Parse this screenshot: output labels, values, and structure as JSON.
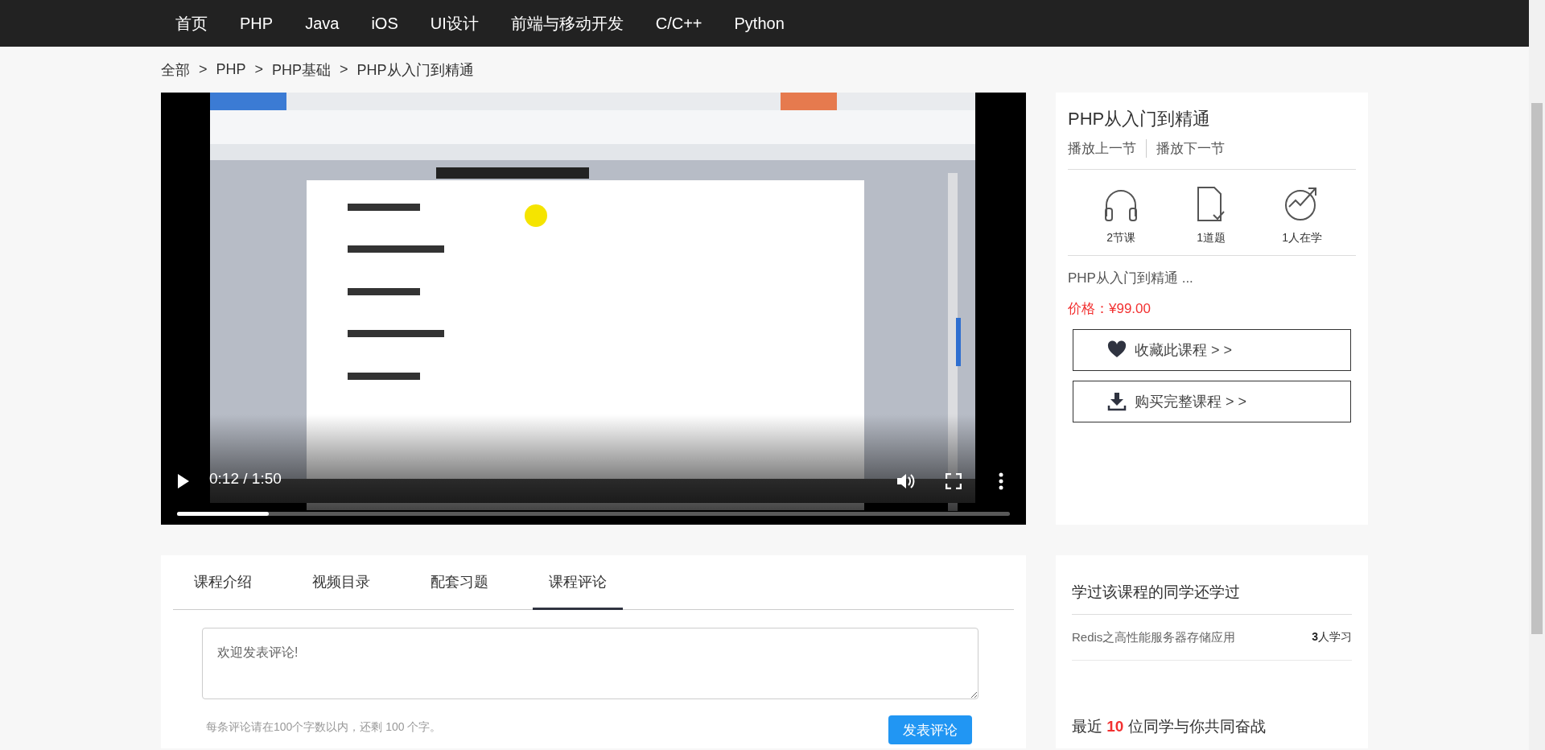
{
  "nav": {
    "items": [
      "首页",
      "PHP",
      "Java",
      "iOS",
      "UI设计",
      "前端与移动开发",
      "C/C++",
      "Python"
    ]
  },
  "breadcrumb": {
    "items": [
      "全部",
      "PHP",
      "PHP基础",
      "PHP从入门到精通"
    ],
    "separators": [
      ">",
      ">",
      ">"
    ]
  },
  "video": {
    "kind": "picture",
    "playing": false,
    "time": "0:12 / 1:50",
    "level": 0.11
  },
  "course": {
    "title": "PHP从入门到精通",
    "prev": "播放上一节",
    "next": "播放下一节",
    "stats": [
      {
        "kind": "headphones",
        "label": "2节课"
      },
      {
        "kind": "document",
        "label": "1道题"
      },
      {
        "kind": "growth",
        "label": "1人在学"
      }
    ],
    "summary": "PHP从入门到精通 ...",
    "price": "价格：¥99.00",
    "actions": [
      {
        "kind": "favorite",
        "label": "收藏此课程 > >"
      },
      {
        "kind": "download",
        "label": "购买完整课程 > >"
      }
    ]
  },
  "tabs": [
    {
      "label": "课程介绍",
      "selected": false
    },
    {
      "label": "视频目录",
      "selected": false
    },
    {
      "label": "配套习题",
      "selected": false
    },
    {
      "label": "课程评论",
      "selected": true
    }
  ],
  "comment": {
    "placeholder": "欢迎发表评论!",
    "hint": "每条评论请在100个字数以内，还剩 100 个字。",
    "submit": "发表评论"
  },
  "related": {
    "title": "学过该课程的同学还学过",
    "courses": [
      {
        "name": "Redis之高性能服务器存储应用",
        "learners": "**3**人学习"
      }
    ]
  },
  "classmates": {
    "title": "最近 **10** 位同学与你共同奋战"
  }
}
